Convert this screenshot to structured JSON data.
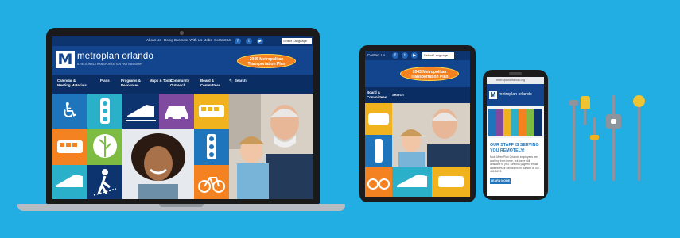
{
  "site": {
    "top_links": [
      "About Us",
      "Doing Business With Us",
      "Jobs",
      "Contact Us"
    ],
    "social_icons": [
      "f",
      "t",
      "▶"
    ],
    "language_label": "Select Language",
    "logo_mark": "M",
    "logo_name": "metroplan orlando",
    "logo_tagline": "A REGIONAL TRANSPORTATION PARTNERSHIP",
    "promo_text": "2045 Metropolitan Transportation Plan",
    "nav": [
      "Calendar & Meeting Materials",
      "Plans",
      "Programs & Resources",
      "Maps & Tools",
      "Community Outreach",
      "Board & Committees"
    ],
    "search_label": "Search",
    "tablet_nav": [
      "Board & Committees"
    ]
  },
  "phone": {
    "url": "metroplanorlando.org",
    "headline": "OUR STAFF IS SERVING YOU REMOTELY!",
    "body": "Most MetroPlan Orlando employees are working from home, but we're still available to you. See this page for email addresses or call our main number at 407-481-5672.",
    "button": "LEARN MORE"
  },
  "colors": {
    "background": "#22aee3",
    "site_navy": "#12458e",
    "promo_orange": "#f58220"
  },
  "icons": [
    "wheelchair-icon",
    "traffic-light-icon",
    "train-icon",
    "car-icon",
    "bus-icon",
    "tree-icon",
    "pedestrian-icon",
    "bicycle-icon"
  ]
}
